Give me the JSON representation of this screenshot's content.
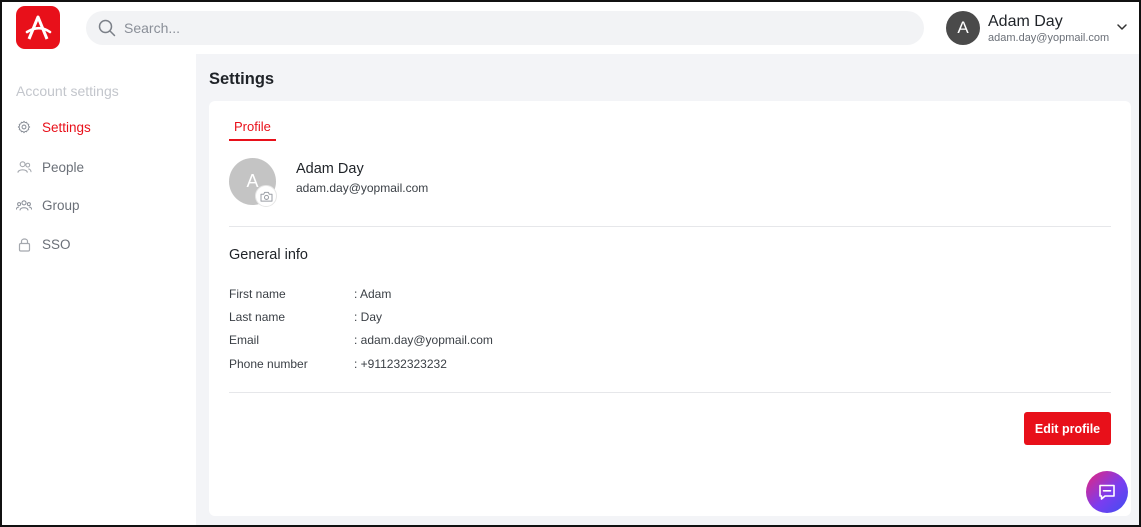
{
  "header": {
    "logo_label": "A",
    "search_placeholder": "Search...",
    "user": {
      "initial": "A",
      "name": "Adam Day",
      "email": "adam.day@yopmail.com"
    }
  },
  "sidebar": {
    "heading": "Account settings",
    "items": [
      {
        "label": "Settings",
        "icon": "gear-icon",
        "active": true
      },
      {
        "label": "People",
        "icon": "people-icon",
        "active": false
      },
      {
        "label": "Group",
        "icon": "group-icon",
        "active": false
      },
      {
        "label": "SSO",
        "icon": "lock-icon",
        "active": false
      }
    ]
  },
  "main": {
    "title": "Settings",
    "tabs": [
      {
        "label": "Profile",
        "active": true
      }
    ],
    "profile": {
      "initial": "A",
      "name": "Adam Day",
      "email": "adam.day@yopmail.com"
    },
    "general_info": {
      "title": "General info",
      "rows": [
        {
          "label": "First name",
          "value": ": Adam"
        },
        {
          "label": "Last name",
          "value": ": Day"
        },
        {
          "label": "Email",
          "value": ": adam.day@yopmail.com"
        },
        {
          "label": "Phone number",
          "value": ": +911232323232"
        }
      ]
    },
    "edit_button": "Edit profile"
  },
  "colors": {
    "accent": "#e8101a",
    "sidebar_heading": "#c3c6cc",
    "main_bg": "#f3f4f7"
  }
}
